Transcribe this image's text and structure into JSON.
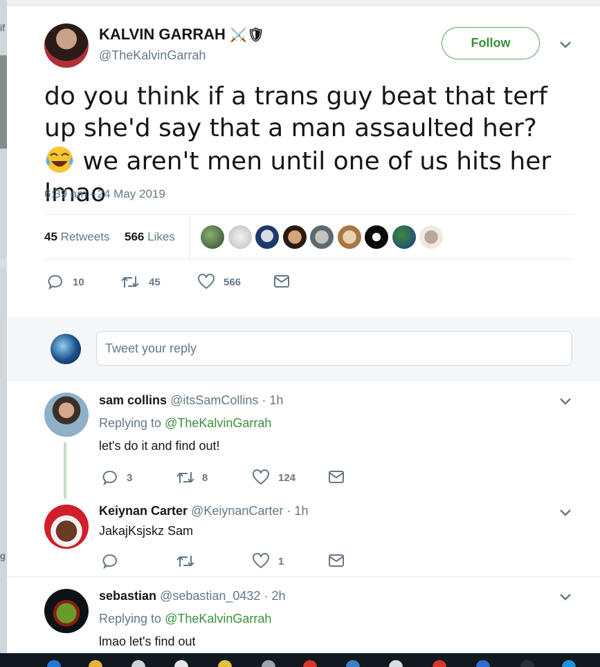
{
  "tweet": {
    "author_name": "KALVIN GARRAH",
    "author_emoji": "⚔️🛡",
    "author_handle": "@TheKalvinGarrah",
    "follow_label": "Follow",
    "text_part1": "do you think if a trans guy beat that terf up she'd say that a man assaulted her?",
    "text_emoji": "😂",
    "text_part2": "we aren't men until one of us hits her lmao",
    "timestamp": "6:39 am - 24 May 2019",
    "retweets_count": "45",
    "retweets_label": "Retweets",
    "likes_count": "566",
    "likes_label": "Likes",
    "actions": {
      "replies": "10",
      "retweets": "45",
      "likes": "566"
    }
  },
  "reply_input": {
    "placeholder": "Tweet your reply"
  },
  "replies": [
    {
      "name": "sam collins",
      "handle": "@itsSamCollins",
      "time": "· 1h",
      "replying_prefix": "Replying to",
      "replying_to": "@TheKalvinGarrah",
      "text": "let's do it and find out!",
      "replies": "3",
      "retweets": "8",
      "likes": "124"
    },
    {
      "name": "Keiynan Carter",
      "handle": "@KeiynanCarter",
      "time": "· 1h",
      "text": "JakajKsjskz Sam",
      "replies": "",
      "retweets": "",
      "likes": "1"
    },
    {
      "name": "sebastian",
      "handle": "@sebastian_0432",
      "time": "· 2h",
      "replying_prefix": "Replying to",
      "replying_to": "@TheKalvinGarrah",
      "text": "lmao let's find out"
    }
  ],
  "left_fragment": {
    "top": "if",
    "bottom": "g"
  },
  "colors": {
    "accent": "#3a8f3a",
    "muted": "#657786",
    "divider": "#e6ecf0"
  }
}
